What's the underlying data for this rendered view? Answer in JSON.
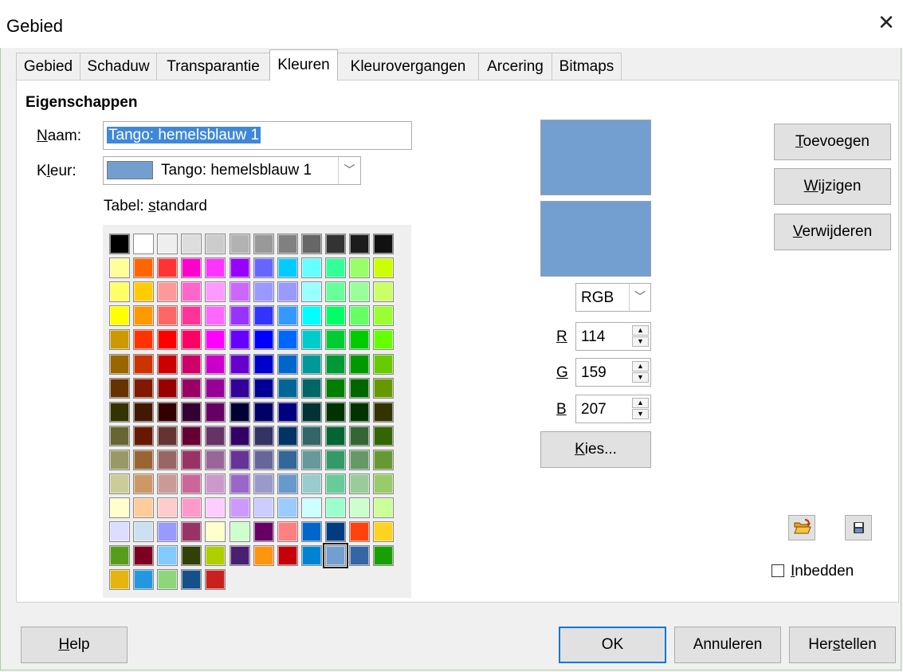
{
  "window": {
    "title": "Gebied"
  },
  "tabs": [
    {
      "label": "Gebied"
    },
    {
      "label": "Schaduw"
    },
    {
      "label": "Transparantie"
    },
    {
      "label": "Kleuren"
    },
    {
      "label": "Kleurovergangen"
    },
    {
      "label": "Arcering"
    },
    {
      "label": "Bitmaps"
    }
  ],
  "active_tab": "Kleuren",
  "properties": {
    "heading": "Eigenschappen",
    "name_label_pre": "",
    "name_label_u": "N",
    "name_label_post": "aam:",
    "name_value": "Tango: hemelsblauw 1",
    "color_label_pre": "K",
    "color_label_u": "l",
    "color_label_post": "eur:",
    "color_value": "Tango: hemelsblauw 1",
    "table_label_pre": "Tabel: ",
    "table_label_u": "s",
    "table_label_post": "tandard"
  },
  "selected_color": "#729fcf",
  "palette": {
    "rows": [
      [
        "#000000",
        "#ffffff",
        "#eeeeee",
        "#dddddd",
        "#cccccc",
        "#b2b2b2",
        "#999999",
        "#808080",
        "#666666",
        "#333333",
        "#1c1c1c",
        "#111111"
      ],
      [
        "#ffff99",
        "#ff6600",
        "#ff3333",
        "#ff00cc",
        "#ff33ff",
        "#9900ff",
        "#6666ff",
        "#00ccff",
        "#66ffff",
        "#33ff99",
        "#99ff66",
        "#ccff00"
      ],
      [
        "#ffff66",
        "#ffcc00",
        "#ff9999",
        "#ff66cc",
        "#ff99ff",
        "#cc66ff",
        "#9999ff",
        "#9999ff",
        "#99ffff",
        "#66ff99",
        "#99ff99",
        "#ccff66"
      ],
      [
        "#ffff00",
        "#ff9900",
        "#ff6666",
        "#ff3399",
        "#ff66ff",
        "#9933ff",
        "#3333ff",
        "#3399ff",
        "#00ffff",
        "#00ff66",
        "#66ff66",
        "#99ff33"
      ],
      [
        "#cc9900",
        "#ff3300",
        "#ff0000",
        "#ff0066",
        "#ff00ff",
        "#6600ff",
        "#0000ff",
        "#0066ff",
        "#00cccc",
        "#00cc33",
        "#00cc00",
        "#66ff00"
      ],
      [
        "#996600",
        "#cc3300",
        "#cc0000",
        "#cc0066",
        "#cc00cc",
        "#6600cc",
        "#0000cc",
        "#0066cc",
        "#009999",
        "#009933",
        "#009900",
        "#66cc00"
      ],
      [
        "#663300",
        "#801900",
        "#990000",
        "#990066",
        "#990099",
        "#330099",
        "#000099",
        "#006699",
        "#006666",
        "#007f00",
        "#006600",
        "#669900"
      ],
      [
        "#333300",
        "#401900",
        "#330000",
        "#330033",
        "#660066",
        "#000033",
        "#000066",
        "#000080",
        "#003333",
        "#003300",
        "#003300",
        "#333300"
      ],
      [
        "#666633",
        "#661900",
        "#663333",
        "#660033",
        "#663366",
        "#330066",
        "#333366",
        "#003366",
        "#336666",
        "#006633",
        "#336633",
        "#336600"
      ],
      [
        "#999966",
        "#996633",
        "#996666",
        "#993366",
        "#996699",
        "#663399",
        "#666699",
        "#336699",
        "#669999",
        "#339966",
        "#669966",
        "#669933"
      ],
      [
        "#cccc99",
        "#cc9966",
        "#cc9999",
        "#cc6699",
        "#cc99cc",
        "#9966cc",
        "#9999cc",
        "#6699cc",
        "#99cccc",
        "#66cc99",
        "#99cc99",
        "#99cc66"
      ],
      [
        "#ffffcc",
        "#ffcc99",
        "#ffcccc",
        "#ff99cc",
        "#ffccff",
        "#cc99ff",
        "#ccccff",
        "#99ccff",
        "#ccffff",
        "#99ffcc",
        "#ccffcc",
        "#ccff99"
      ],
      [
        "#ddddff",
        "#cce0f0",
        "#9999ff",
        "#993366",
        "#ffffcc",
        "#ccffcc",
        "#660066",
        "#ff8080",
        "#0066cc",
        "#003d80",
        "#ff420e",
        "#ffd320"
      ],
      [
        "#579d1c",
        "#7e0021",
        "#83caff",
        "#314004",
        "#aecf00",
        "#4b1f6f",
        "#ff950e",
        "#c5000b",
        "#0084d1",
        "#729fcf",
        "#3465a4",
        "#1a9f00"
      ],
      [
        "#e6b40f",
        "#2398e1",
        "#8ed67c",
        "#15508a",
        "#c9211e"
      ]
    ]
  },
  "color_mode": {
    "value": "RGB"
  },
  "rgb": {
    "r_label": "R",
    "r_value": "114",
    "g_label": "G",
    "g_value": "159",
    "b_label": "B",
    "b_value": "207"
  },
  "buttons": {
    "pick_u": "K",
    "pick_rest": "ies...",
    "add_u": "T",
    "add_rest": "oevoegen",
    "modify_u": "W",
    "modify_rest": "ijzigen",
    "delete_u": "V",
    "delete_rest": "erwijderen",
    "embed_u": "I",
    "embed_rest": "nbedden",
    "help_u": "H",
    "help_rest": "elp",
    "ok": "OK",
    "cancel": "Annuleren",
    "reset_pre": "Her",
    "reset_u": "s",
    "reset_post": "tellen"
  },
  "icons": {
    "load": "folder-open-icon",
    "save": "floppy-disk-icon",
    "close": "close-icon"
  }
}
